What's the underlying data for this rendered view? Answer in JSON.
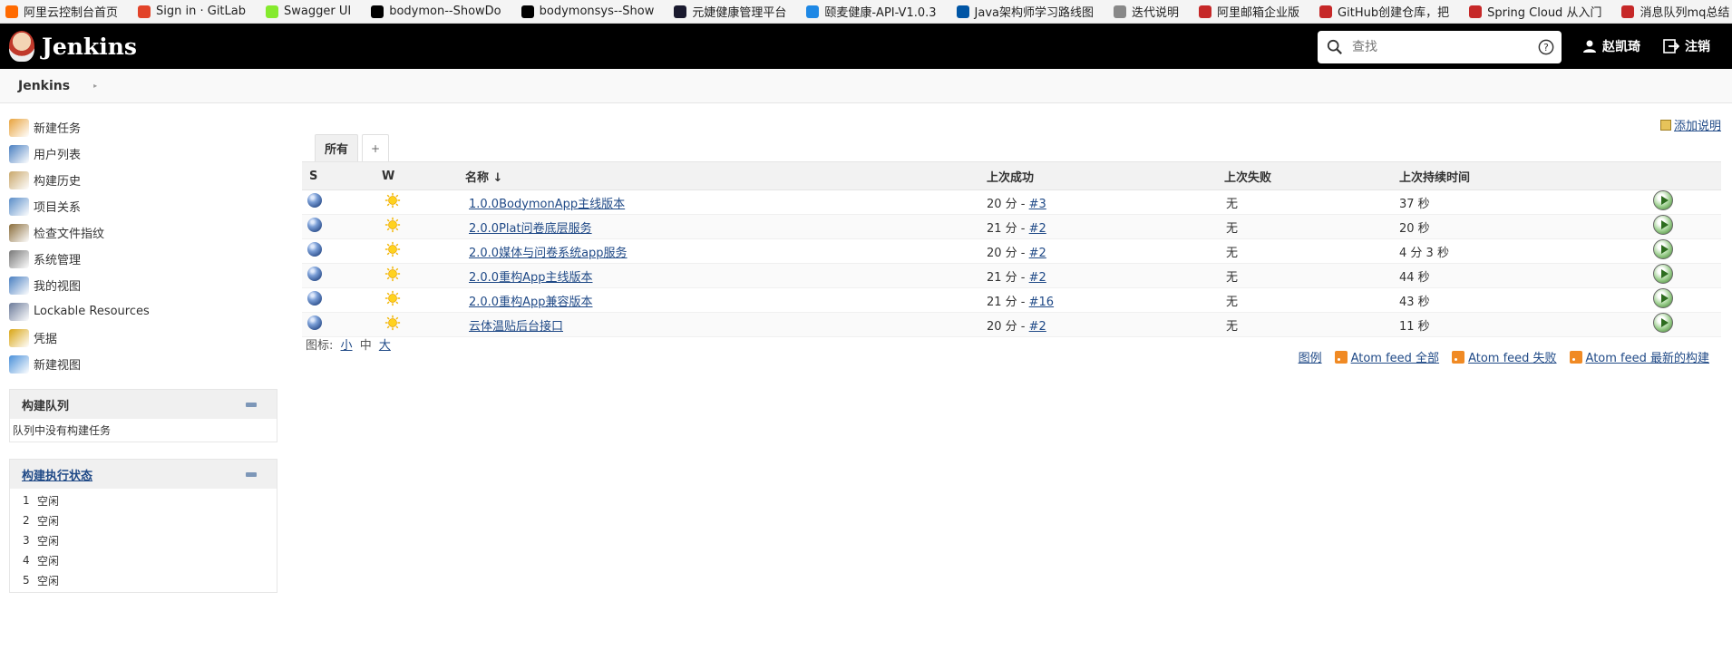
{
  "bookmarks": [
    {
      "label": "阿里云控制台首页",
      "color": "#ff6a00"
    },
    {
      "label": "Sign in · GitLab",
      "color": "#e24329"
    },
    {
      "label": "Swagger UI",
      "color": "#85ea2d"
    },
    {
      "label": "bodymon--ShowDo",
      "color": "#000000"
    },
    {
      "label": "bodymonsys--Show",
      "color": "#000000"
    },
    {
      "label": "元婕健康管理平台",
      "color": "#1a1a2e"
    },
    {
      "label": "颐麦健康-API-V1.0.3",
      "color": "#1e88e5"
    },
    {
      "label": "Java架构师学习路线图",
      "color": "#0055a5"
    },
    {
      "label": "迭代说明",
      "color": "#888888"
    },
    {
      "label": "阿里邮箱企业版",
      "color": "#c62828"
    },
    {
      "label": "GitHub创建仓库，把",
      "color": "#c62828"
    },
    {
      "label": "Spring Cloud 从入门",
      "color": "#c62828"
    },
    {
      "label": "消息队列mq总结（重",
      "color": "#c62828"
    }
  ],
  "bookmarks_more": "»",
  "header": {
    "title": "Jenkins",
    "search_placeholder": "查找",
    "user": "赵凯琦",
    "logout": "注销"
  },
  "breadcrumb": {
    "root": "Jenkins"
  },
  "sidebar": {
    "tasks": [
      {
        "label": "新建任务",
        "icon": "new-job-icon",
        "color": "#e8a33d"
      },
      {
        "label": "用户列表",
        "icon": "people-icon",
        "color": "#4a7fc1"
      },
      {
        "label": "构建历史",
        "icon": "notepad-icon",
        "color": "#c9a76b"
      },
      {
        "label": "项目关系",
        "icon": "search-icon",
        "color": "#5a8dc8"
      },
      {
        "label": "检查文件指纹",
        "icon": "fingerprint-icon",
        "color": "#8a6d3b"
      },
      {
        "label": "系统管理",
        "icon": "gear-icon",
        "color": "#777777"
      },
      {
        "label": "我的视图",
        "icon": "user-icon",
        "color": "#4a7fc1"
      },
      {
        "label": "Lockable Resources",
        "icon": "lock-icon",
        "color": "#6b7a99"
      },
      {
        "label": "凭据",
        "icon": "credentials-icon",
        "color": "#d9a514"
      },
      {
        "label": "新建视图",
        "icon": "folder-icon",
        "color": "#4a90d9"
      }
    ],
    "queue": {
      "title": "构建队列",
      "empty_text": "队列中没有构建任务"
    },
    "executors": {
      "title": "构建执行状态",
      "rows": [
        {
          "num": "1",
          "status": "空闲"
        },
        {
          "num": "2",
          "status": "空闲"
        },
        {
          "num": "3",
          "status": "空闲"
        },
        {
          "num": "4",
          "status": "空闲"
        },
        {
          "num": "5",
          "status": "空闲"
        }
      ]
    }
  },
  "main": {
    "add_description": "添加说明",
    "tabs": [
      {
        "label": "所有"
      },
      {
        "label": "+"
      }
    ],
    "columns": {
      "s": "S",
      "w": "W",
      "name": "名称 ↓",
      "last_success": "上次成功",
      "last_failure": "上次失败",
      "last_duration": "上次持续时间"
    },
    "jobs": [
      {
        "name": "1.0.0BodymonApp主线版本",
        "success_time": "20 分 - ",
        "success_build": "#3",
        "failure": "无",
        "duration": "37 秒"
      },
      {
        "name": "2.0.0Plat问卷底层服务",
        "success_time": "21 分 - ",
        "success_build": "#2",
        "failure": "无",
        "duration": "20 秒"
      },
      {
        "name": "2.0.0媒体与问卷系统app服务",
        "success_time": "20 分 - ",
        "success_build": "#2",
        "failure": "无",
        "duration": "4 分 3 秒"
      },
      {
        "name": "2.0.0重构App主线版本",
        "success_time": "21 分 - ",
        "success_build": "#2",
        "failure": "无",
        "duration": "44 秒"
      },
      {
        "name": "2.0.0重构App兼容版本",
        "success_time": "21 分 - ",
        "success_build": "#16",
        "failure": "无",
        "duration": "43 秒"
      },
      {
        "name": "云体温贴后台接口",
        "success_time": "20 分 - ",
        "success_build": "#2",
        "failure": "无",
        "duration": "11 秒"
      }
    ],
    "icon_size": {
      "label": "图标:",
      "small": "小",
      "medium": "中",
      "large": "大"
    },
    "footer": {
      "legend": "图例",
      "feed_all": "Atom feed 全部",
      "feed_failed": "Atom feed 失败",
      "feed_latest": "Atom feed 最新的构建"
    }
  }
}
